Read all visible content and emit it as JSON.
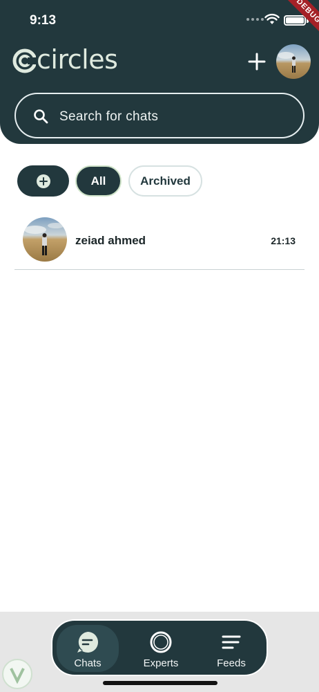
{
  "status_bar": {
    "time": "9:13",
    "debug_label": "DEBUG"
  },
  "header": {
    "app_name": "circles",
    "search_placeholder": "Search for chats"
  },
  "filters": {
    "all_label": "All",
    "archived_label": "Archived"
  },
  "chats": [
    {
      "name": "zeiad ahmed",
      "time": "21:13"
    }
  ],
  "bottom_nav": {
    "items": [
      {
        "label": "Chats",
        "icon": "chat-bubble-icon",
        "active": true
      },
      {
        "label": "Experts",
        "icon": "circle-ring-icon",
        "active": false
      },
      {
        "label": "Feeds",
        "icon": "lines-icon",
        "active": false
      }
    ]
  },
  "colors": {
    "primary": "#22383d",
    "accent": "#cfe3c9",
    "background": "#ffffff",
    "nav_background": "#e6e6e6",
    "debug_ribbon": "#a42127"
  }
}
